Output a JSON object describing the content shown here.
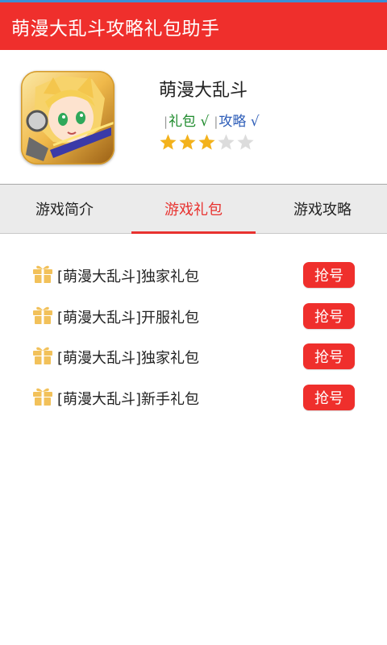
{
  "app": {
    "title": "萌漫大乱斗攻略礼包助手"
  },
  "game": {
    "name": "萌漫大乱斗",
    "tags": [
      "礼包 √",
      "攻略 √"
    ],
    "rating": 3,
    "rating_max": 5,
    "icon": "anime-character-icon"
  },
  "tabs": [
    {
      "label": "游戏简介",
      "active": false
    },
    {
      "label": "游戏礼包",
      "active": true
    },
    {
      "label": "游戏攻略",
      "active": false
    }
  ],
  "gifts": [
    {
      "name": "[萌漫大乱斗]独家礼包",
      "button": "抢号"
    },
    {
      "name": "[萌漫大乱斗]开服礼包",
      "button": "抢号"
    },
    {
      "name": "[萌漫大乱斗]独家礼包",
      "button": "抢号"
    },
    {
      "name": "[萌漫大乱斗]新手礼包",
      "button": "抢号"
    }
  ],
  "colors": {
    "accent": "#ef2f2c",
    "star_on": "#f3b21c",
    "star_off": "#dcdcdc",
    "gift_icon": "#f2c15a"
  }
}
